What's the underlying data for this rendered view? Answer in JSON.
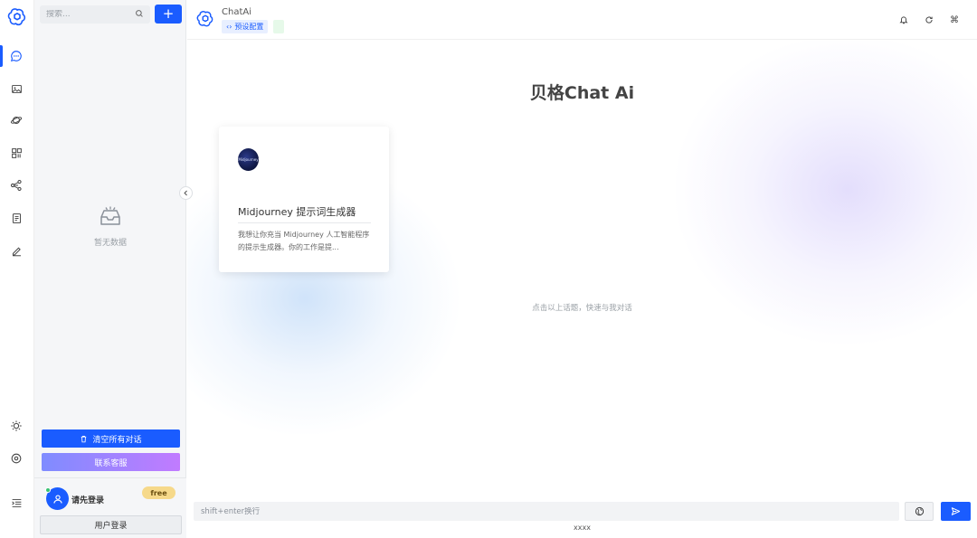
{
  "sidebar": {
    "search_placeholder": "搜索...",
    "add_label": "+",
    "empty_text": "暂无数据",
    "clear_label": "清空所有对话",
    "contact_label": "联系客服",
    "user": {
      "name": "请先登录",
      "badge": "free",
      "login_label": "用户登录"
    }
  },
  "rail": {
    "items": [
      "chat-icon",
      "image-icon",
      "planet-icon",
      "apps-icon",
      "share-icon",
      "document-icon",
      "edit-icon"
    ],
    "bottom": [
      "sun-icon",
      "settings-icon",
      "menu-collapse-icon"
    ]
  },
  "header": {
    "title": "ChatAi",
    "preset_label": "预设配置"
  },
  "main": {
    "heading": "贝格Chat Ai",
    "hint": "点击以上话题，快速与我对话",
    "input_placeholder": "shift+enter换行",
    "footer": "xxxx"
  },
  "cards": [
    {
      "avatar_text": "Midjourney",
      "title": "Midjourney 提示词生成器",
      "description": "我想让你充当 Midjourney 人工智能程序的提示生成器。你的工作是提..."
    }
  ],
  "colors": {
    "primary": "#1a5cff",
    "contact_gradient_start": "#7f8cff",
    "contact_gradient_end": "#c17bff",
    "badge": "#f6d98a"
  }
}
